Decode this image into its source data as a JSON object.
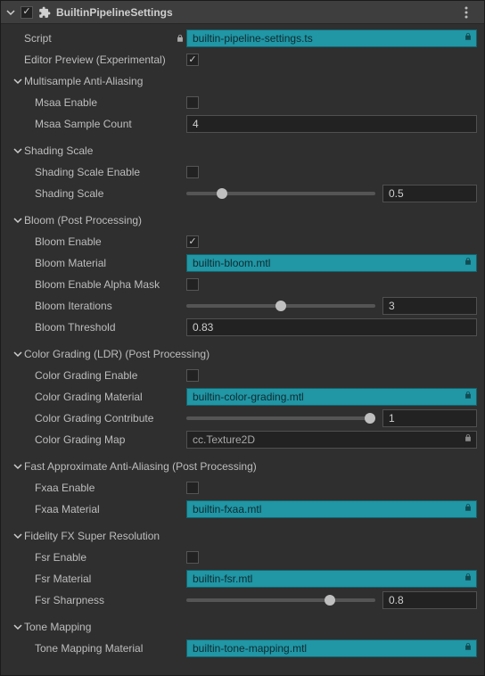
{
  "component": {
    "enabled": true,
    "name": "BuiltinPipelineSettings"
  },
  "script": {
    "label": "Script",
    "value": "builtin-pipeline-settings.ts",
    "locked": true
  },
  "editorPreview": {
    "label": "Editor Preview (Experimental)",
    "checked": true
  },
  "msaa": {
    "section": "Multisample Anti-Aliasing",
    "enable": {
      "label": "Msaa Enable",
      "checked": false
    },
    "count": {
      "label": "Msaa Sample Count",
      "value": "4"
    }
  },
  "shadingScale": {
    "section": "Shading Scale",
    "enable": {
      "label": "Shading Scale Enable",
      "checked": false
    },
    "scale": {
      "label": "Shading Scale",
      "value": "0.5",
      "pct": 19
    }
  },
  "bloom": {
    "section": "Bloom (Post Processing)",
    "enable": {
      "label": "Bloom Enable",
      "checked": true
    },
    "material": {
      "label": "Bloom Material",
      "value": "builtin-bloom.mtl"
    },
    "alphaMask": {
      "label": "Bloom Enable Alpha Mask",
      "checked": false
    },
    "iterations": {
      "label": "Bloom Iterations",
      "value": "3",
      "pct": 50
    },
    "threshold": {
      "label": "Bloom Threshold",
      "value": "0.83"
    }
  },
  "colorGrading": {
    "section": "Color Grading (LDR) (Post Processing)",
    "enable": {
      "label": "Color Grading Enable",
      "checked": false
    },
    "material": {
      "label": "Color Grading Material",
      "value": "builtin-color-grading.mtl"
    },
    "contribute": {
      "label": "Color Grading Contribute",
      "value": "1",
      "pct": 97
    },
    "map": {
      "label": "Color Grading Map",
      "value": "cc.Texture2D"
    }
  },
  "fxaa": {
    "section": "Fast Approximate Anti-Aliasing (Post Processing)",
    "enable": {
      "label": "Fxaa Enable",
      "checked": false
    },
    "material": {
      "label": "Fxaa Material",
      "value": "builtin-fxaa.mtl"
    }
  },
  "fsr": {
    "section": "Fidelity FX Super Resolution",
    "enable": {
      "label": "Fsr Enable",
      "checked": false
    },
    "material": {
      "label": "Fsr Material",
      "value": "builtin-fsr.mtl"
    },
    "sharpness": {
      "label": "Fsr Sharpness",
      "value": "0.8",
      "pct": 76
    }
  },
  "toneMapping": {
    "section": "Tone Mapping",
    "material": {
      "label": "Tone Mapping Material",
      "value": "builtin-tone-mapping.mtl"
    }
  }
}
